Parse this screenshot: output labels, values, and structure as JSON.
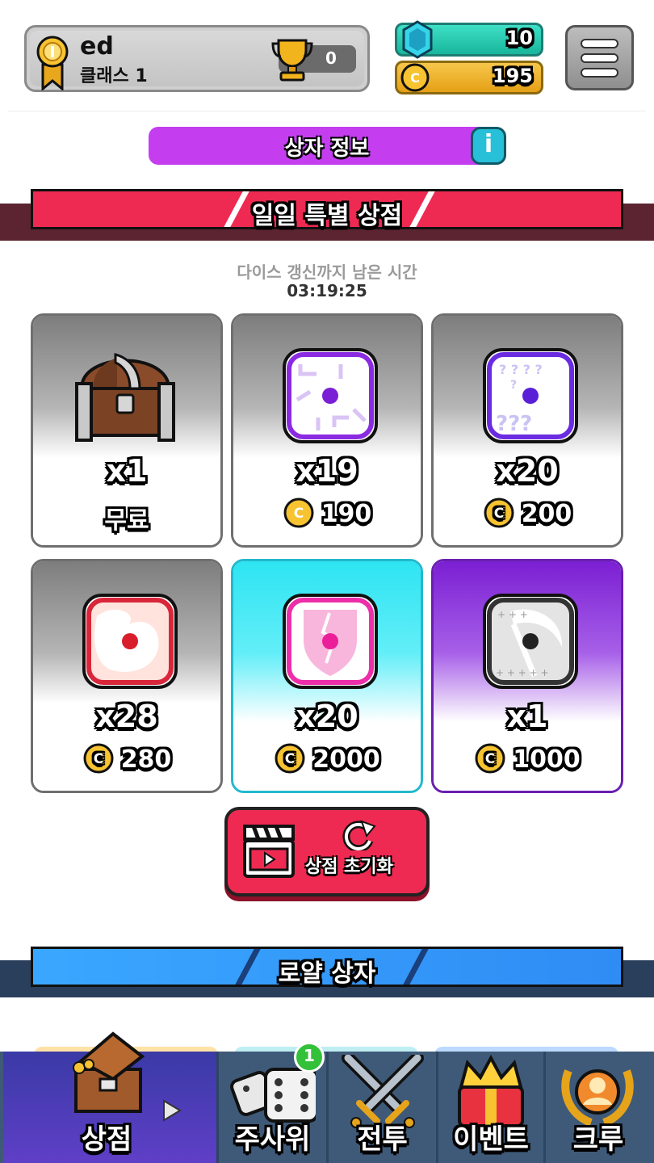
{
  "profile": {
    "name": "ed",
    "class_label": "클래스 1",
    "trophies": "0"
  },
  "resources": {
    "gems": "10",
    "coins": "195"
  },
  "icons": {
    "medal": "medal-icon",
    "trophy": "trophy-icon",
    "gem": "gem-icon",
    "coin": "coin-icon",
    "menu": "hamburger-icon",
    "info": "info-icon"
  },
  "info_bar": {
    "label": "상자 정보",
    "info_glyph": "i"
  },
  "daily_shop": {
    "title": "일일 특별 상점",
    "timer_label": "다이스 갱신까지 남은 시간",
    "timer": "03:19:25",
    "items": [
      {
        "icon": "treasure-chest-icon",
        "qty": "x1",
        "price": "무료",
        "free": true
      },
      {
        "icon": "arrow-dice-icon",
        "qty": "x19",
        "price": "190",
        "free": false
      },
      {
        "icon": "question-dice-icon",
        "qty": "x20",
        "price": "200",
        "free": false
      },
      {
        "icon": "fire-dice-icon",
        "qty": "x28",
        "price": "280",
        "free": false
      },
      {
        "icon": "shield-dice-icon",
        "qty": "x20",
        "price": "2000",
        "free": false
      },
      {
        "icon": "scythe-dice-icon",
        "qty": "x1",
        "price": "1000",
        "free": false
      }
    ],
    "reset_label": "상점 초기화"
  },
  "royal_box": {
    "title": "로얄 상자"
  },
  "nav": {
    "items": [
      {
        "label": "상점",
        "icon": "shop-chest-icon",
        "active": true
      },
      {
        "label": "주사위",
        "icon": "dice-icon",
        "badge": "1"
      },
      {
        "label": "전투",
        "icon": "crossed-swords-icon"
      },
      {
        "label": "이벤트",
        "icon": "crown-gift-icon"
      },
      {
        "label": "크루",
        "icon": "laurel-crew-icon"
      }
    ]
  },
  "colors": {
    "accent_red": "#ee2a52",
    "accent_purple": "#c43ef0",
    "accent_blue": "#3aa7ff",
    "nav_bg": "#3f5a78"
  }
}
